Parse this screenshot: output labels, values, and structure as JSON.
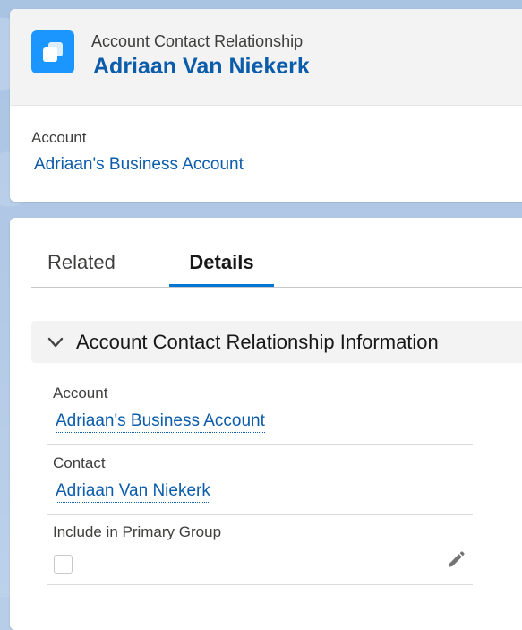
{
  "header": {
    "record_type": "Account Contact Relationship",
    "record_name": "Adriaan Van Niekerk",
    "icon": "account-contact-relationship-icon",
    "icon_color": "#1b96ff",
    "highlight_label": "Account",
    "highlight_value": "Adriaan's Business Account"
  },
  "tabs": [
    {
      "label": "Related",
      "active": false
    },
    {
      "label": "Details",
      "active": true
    }
  ],
  "section": {
    "title": "Account Contact Relationship Information",
    "expanded": true
  },
  "fields": {
    "account": {
      "label": "Account",
      "value": "Adriaan's Business Account"
    },
    "contact": {
      "label": "Contact",
      "value": "Adriaan Van Niekerk"
    },
    "include_primary_group": {
      "label": "Include in Primary Group",
      "checked": false
    }
  },
  "colors": {
    "link": "#0b5cab",
    "active_tab": "#0176d3",
    "background": "#b7cde8"
  }
}
